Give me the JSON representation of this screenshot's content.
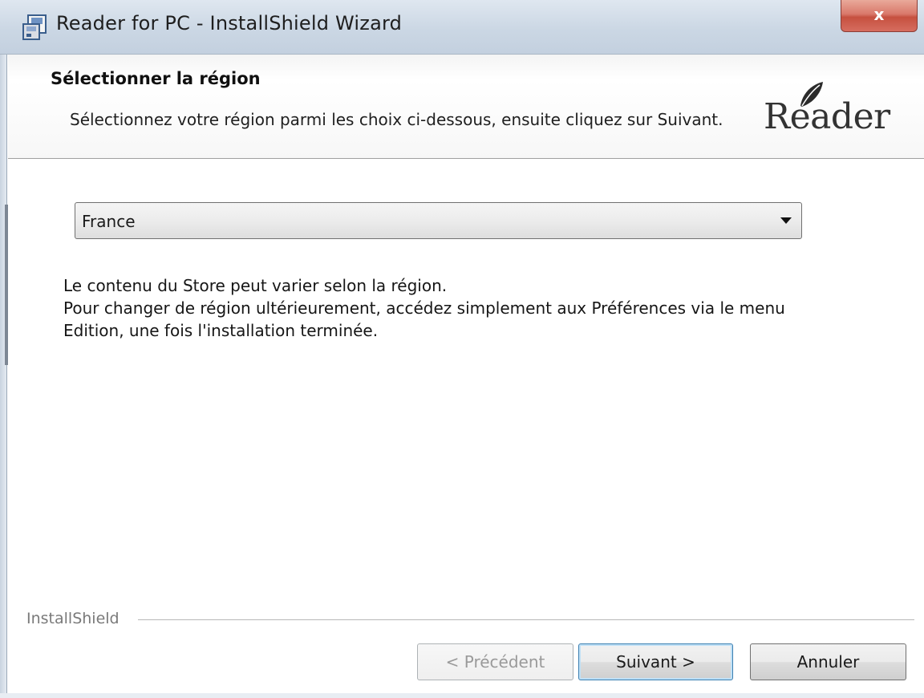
{
  "window": {
    "title": "Reader for PC - InstallShield Wizard",
    "close_label": "x"
  },
  "header": {
    "title": "Sélectionner la région",
    "subtitle": "Sélectionnez votre région parmi les choix ci-dessous, ensuite cliquez sur Suivant.",
    "logo_text": "Reader"
  },
  "region_select": {
    "selected": "France"
  },
  "info": {
    "line1": "Le contenu du Store peut varier selon la région.",
    "line2": "Pour changer de région ultérieurement, accédez simplement aux Préférences via le menu",
    "line3": "Edition, une fois l'installation terminée."
  },
  "footer": {
    "brand": "InstallShield",
    "prev_label": "< Précédent",
    "next_label": "Suivant >",
    "cancel_label": "Annuler"
  },
  "icons": {
    "app": "installer-icon",
    "logo": "leaf-icon",
    "dropdown": "chevron-down-icon",
    "close": "close-icon"
  },
  "colors": {
    "titlebar": "#cbd7e4",
    "close_button": "#c6503f",
    "default_button_border": "#3c7fb1"
  }
}
